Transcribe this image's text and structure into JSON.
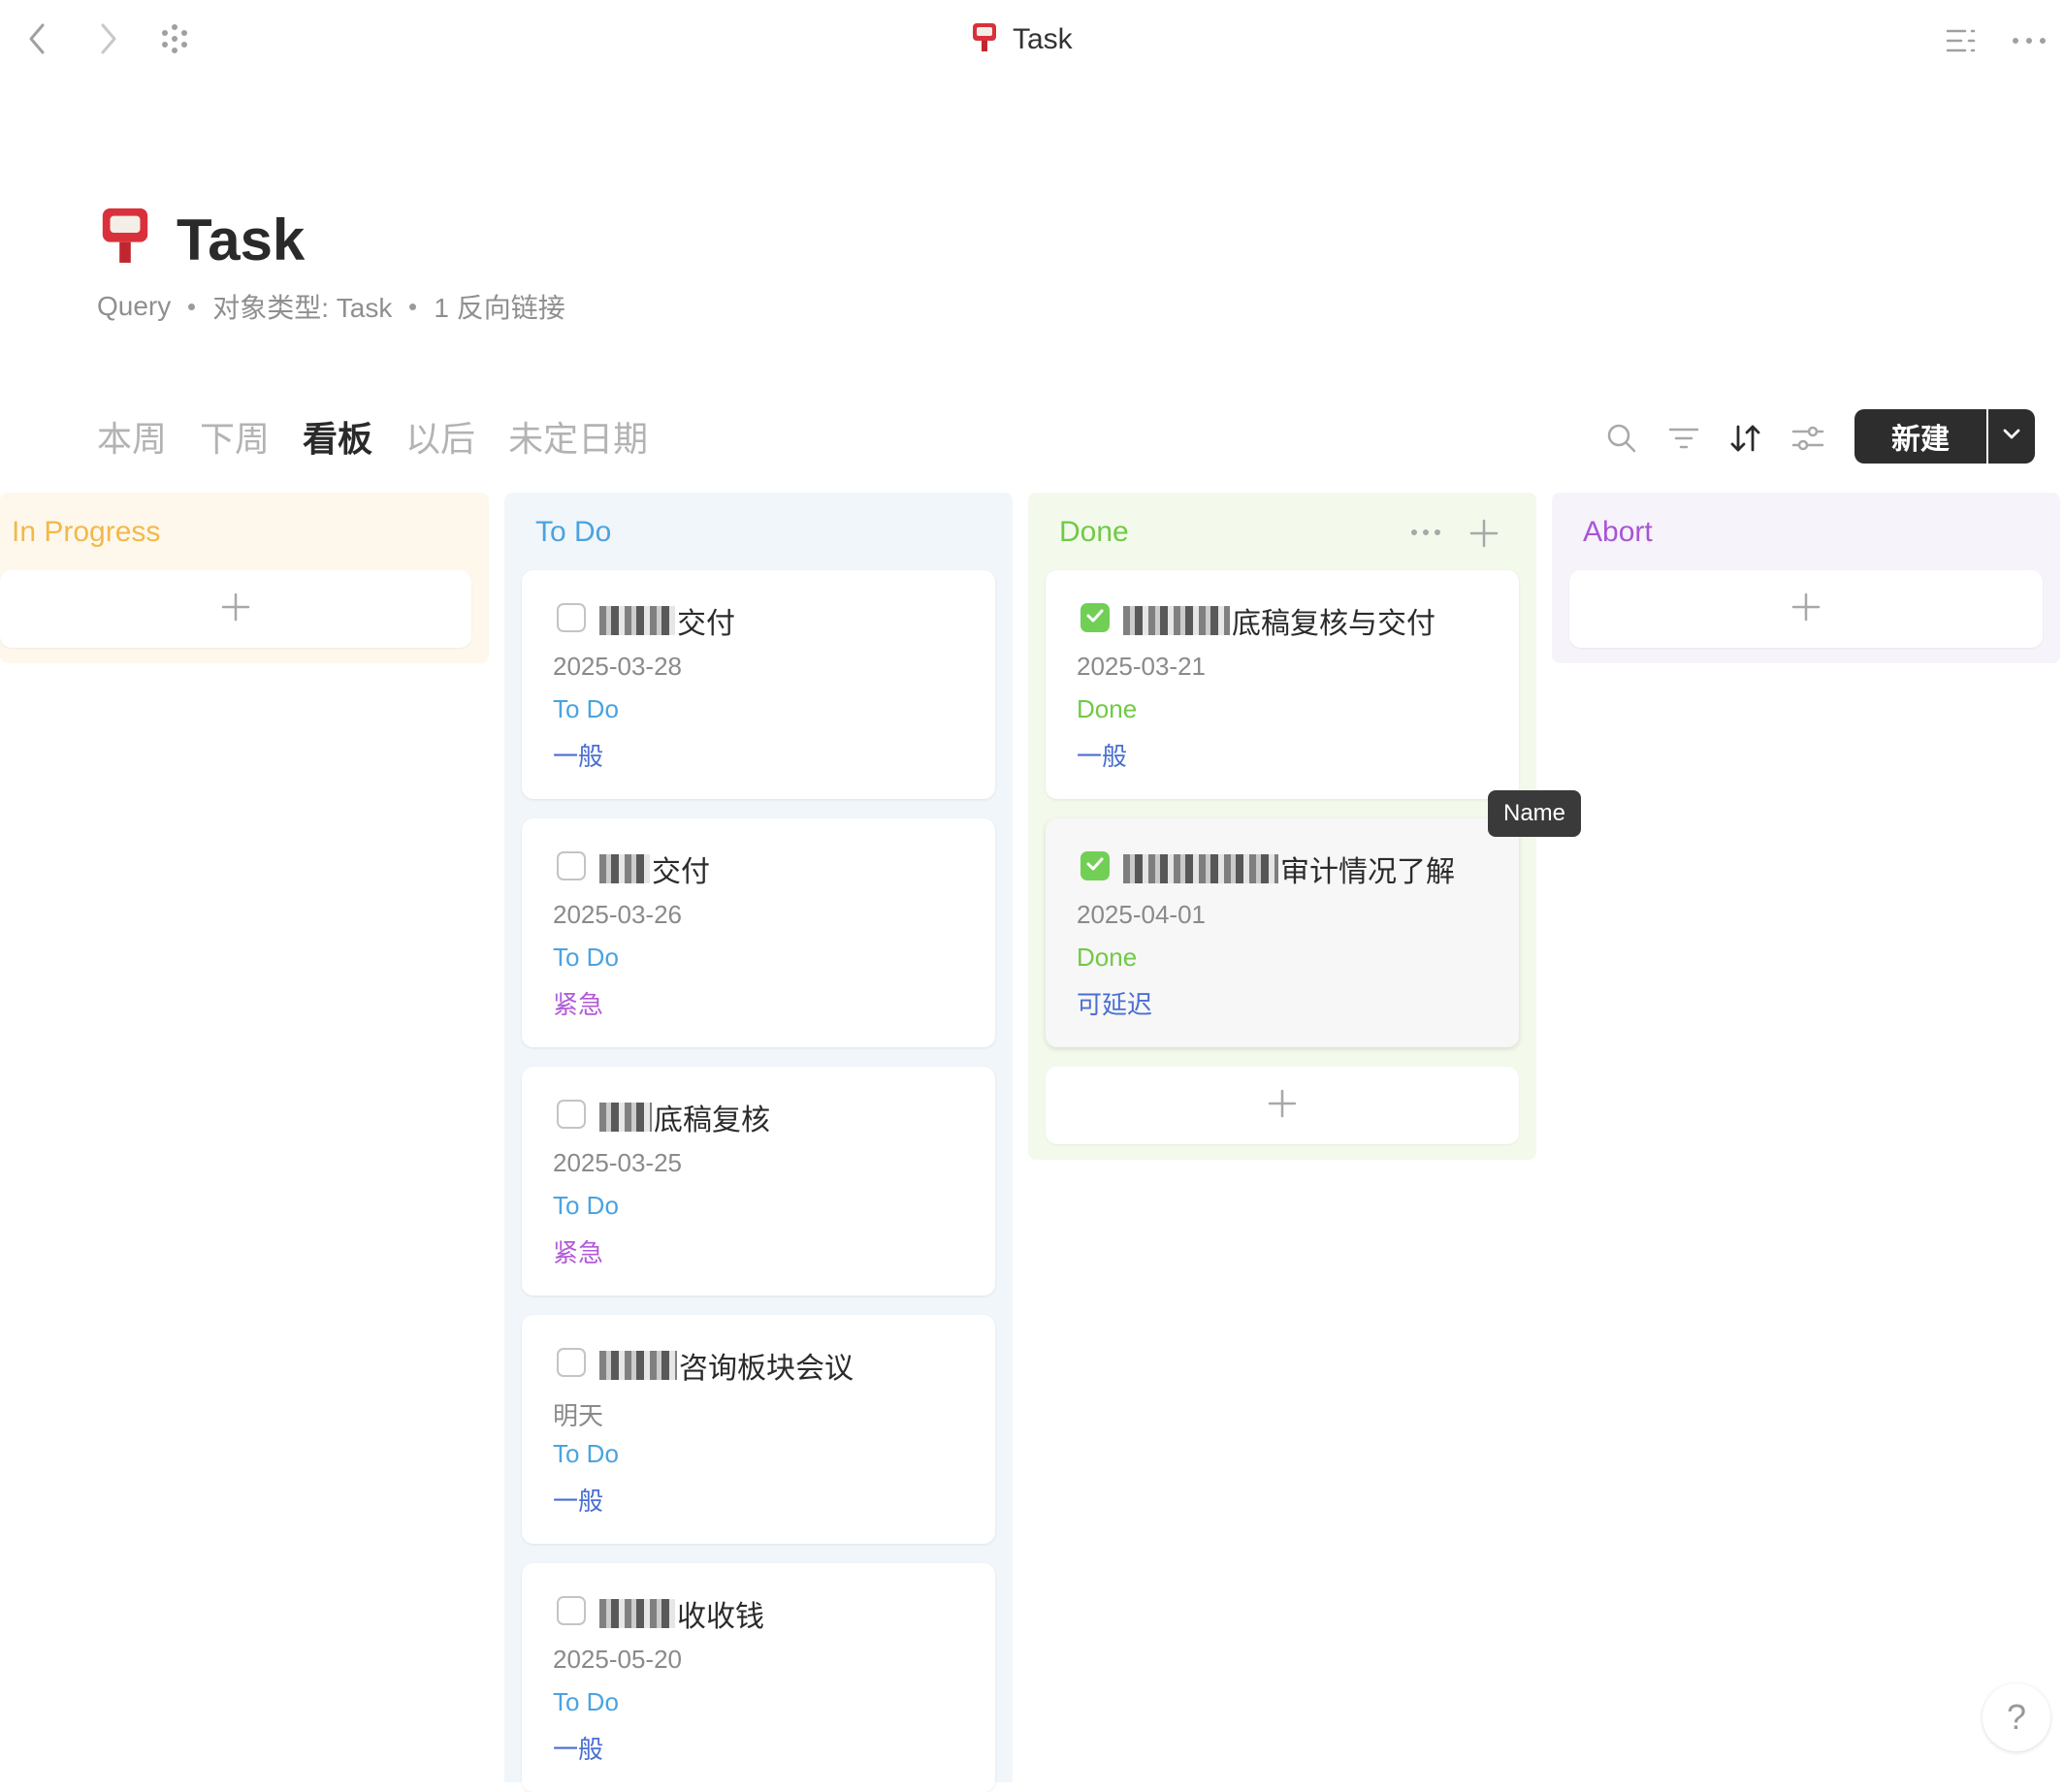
{
  "window": {
    "title": "Task",
    "page_icon": "postbox-icon"
  },
  "header": {
    "title": "Task",
    "meta": [
      "Query",
      "对象类型: Task",
      "1 反向链接"
    ]
  },
  "tabs": [
    {
      "label": "本周",
      "active": false
    },
    {
      "label": "下周",
      "active": false
    },
    {
      "label": "看板",
      "active": true
    },
    {
      "label": "以后",
      "active": false
    },
    {
      "label": "未定日期",
      "active": false
    }
  ],
  "toolbar": {
    "new_label": "新建"
  },
  "colors": {
    "in_progress": "#f3b84a",
    "todo": "#4aa3e0",
    "done": "#71c946",
    "abort": "#a855d6",
    "priority_normal": "#4a6fd1",
    "priority_urgent": "#b25ad8",
    "priority_defer": "#4a6fd1"
  },
  "columns": {
    "in_progress": {
      "title": "In Progress"
    },
    "todo": {
      "title": "To Do",
      "cards": [
        {
          "name": "交付",
          "date": "2025-03-28",
          "status": "To Do",
          "priority": "一般"
        },
        {
          "name": "交付",
          "date": "2025-03-26",
          "status": "To Do",
          "priority": "紧急"
        },
        {
          "name": "底稿复核",
          "date": "2025-03-25",
          "status": "To Do",
          "priority": "紧急"
        },
        {
          "name": "咨询板块会议",
          "date": "明天",
          "status": "To Do",
          "priority": "一般"
        },
        {
          "name": "收收钱",
          "date": "2025-05-20",
          "status": "To Do",
          "priority": "一般"
        }
      ]
    },
    "done": {
      "title": "Done",
      "cards": [
        {
          "name": "底稿复核与交付",
          "date": "2025-03-21",
          "status": "Done",
          "priority": "一般"
        },
        {
          "name": "审计情况了解",
          "date": "2025-04-01",
          "status": "Done",
          "priority": "可延迟"
        }
      ]
    },
    "abort": {
      "title": "Abort"
    }
  },
  "tooltip": {
    "text": "Name"
  },
  "help": {
    "label": "?"
  }
}
